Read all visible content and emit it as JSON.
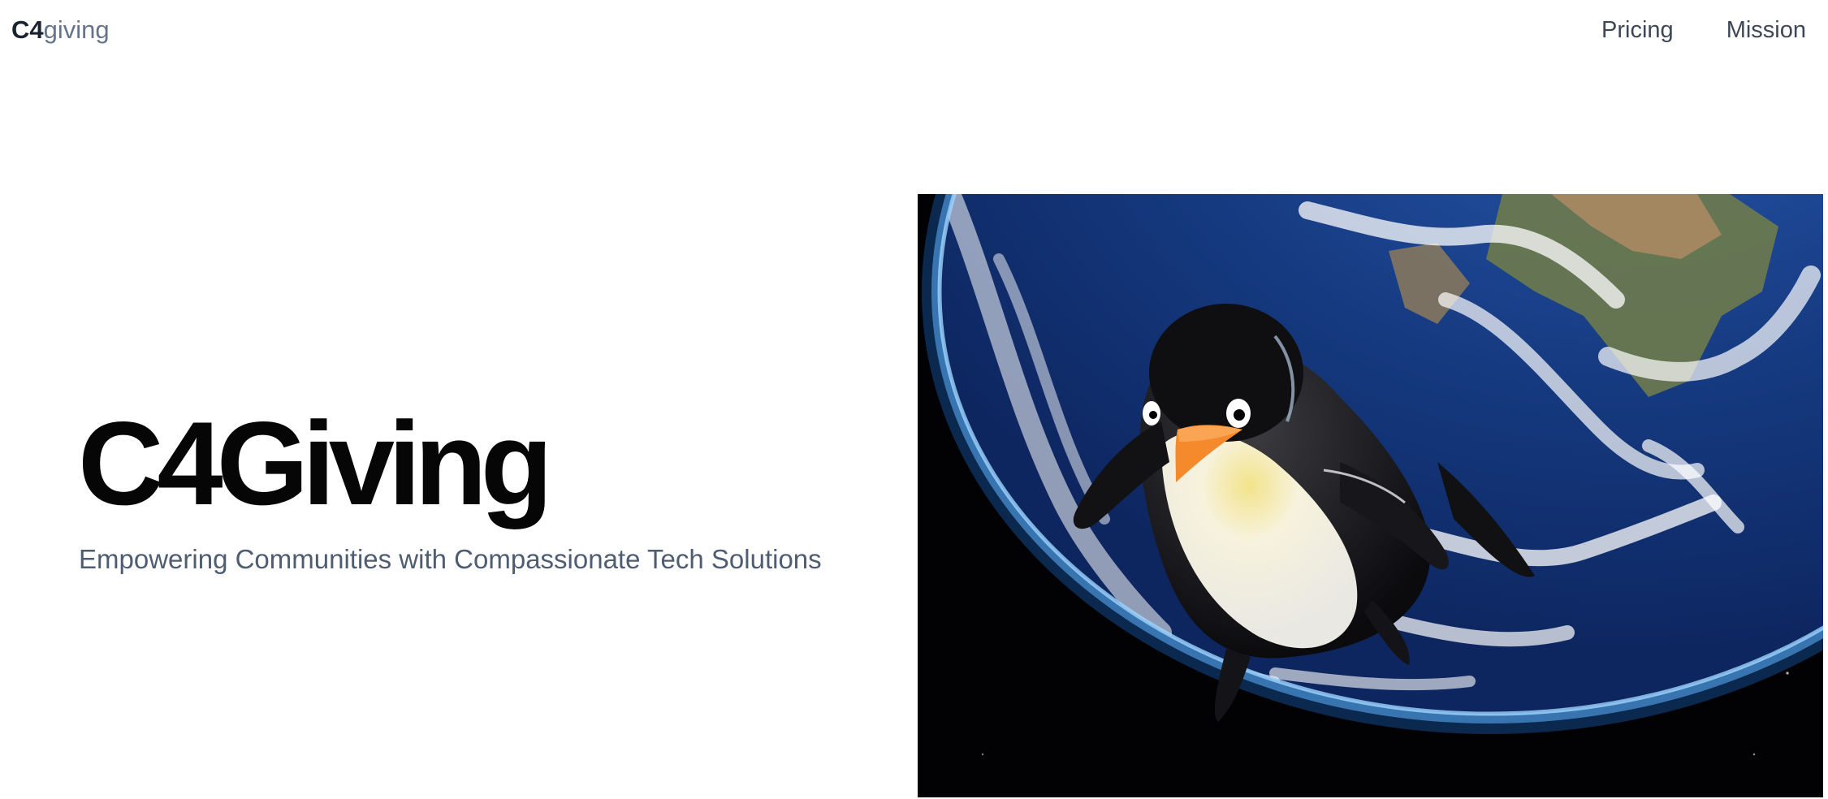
{
  "header": {
    "logo_strong": "C4",
    "logo_light": "giving",
    "nav": [
      {
        "label": "Pricing"
      },
      {
        "label": "Mission"
      }
    ]
  },
  "hero": {
    "title": "C4Giving",
    "subtitle": "Empowering Communities with Compassionate Tech Solutions",
    "image_icon": "penguin-over-earth-illustration"
  },
  "colors": {
    "logo_strong": "#1b2230",
    "logo_light": "#66738a",
    "nav_text": "#3e4756",
    "title": "#060606",
    "subtitle": "#4f5d72",
    "space": "#020205",
    "ocean": "#173f86"
  }
}
